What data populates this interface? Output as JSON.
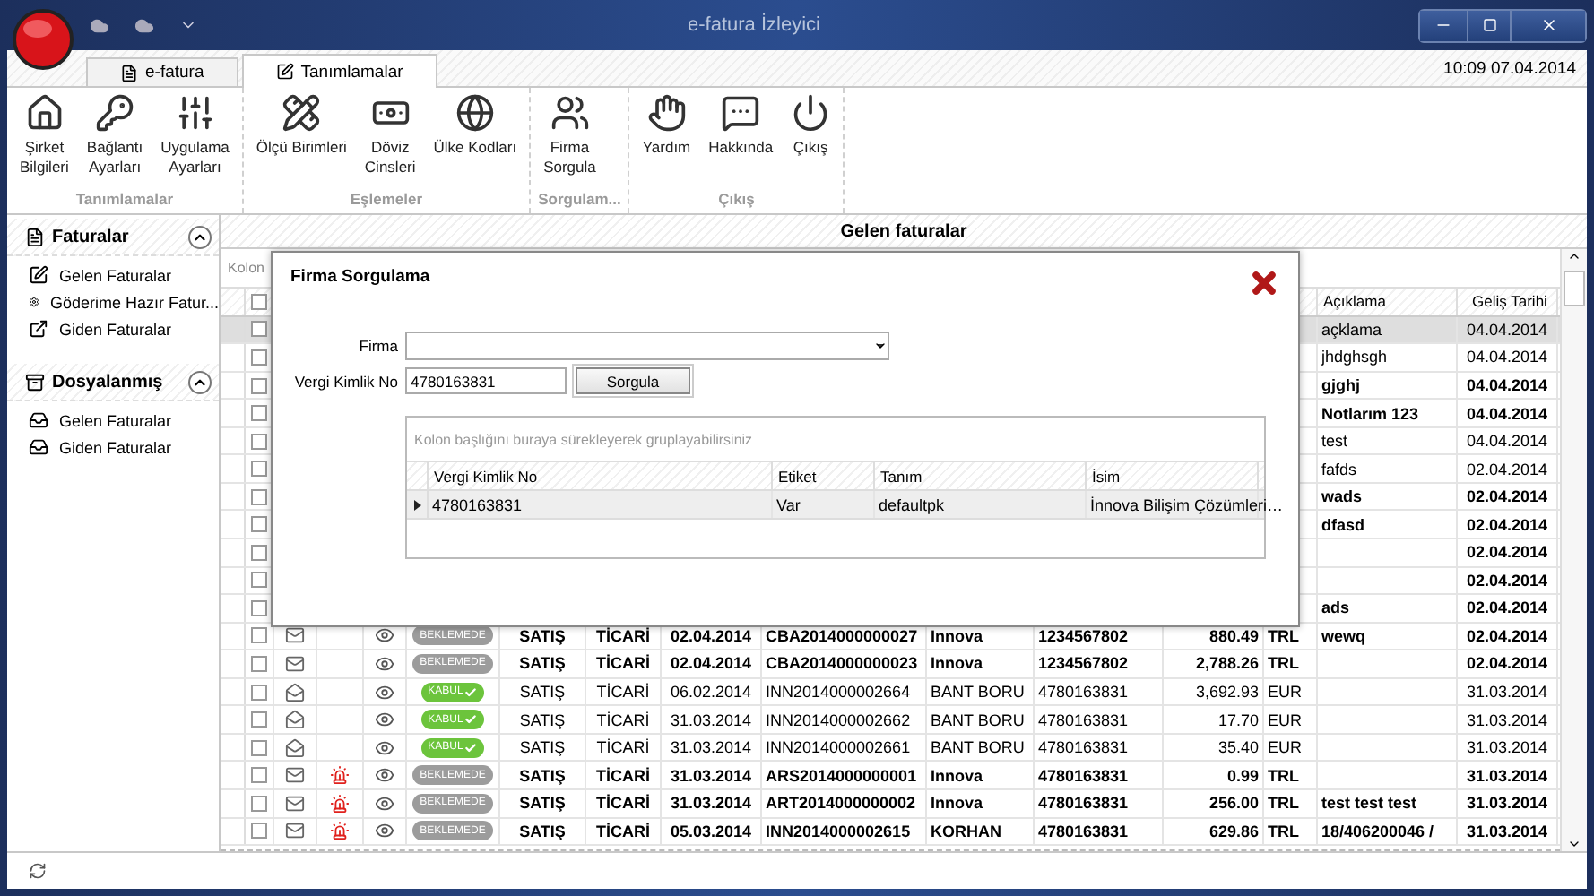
{
  "window": {
    "title": "e-fatura İzleyici",
    "time": "10:09 07.04.2014"
  },
  "ribbon": {
    "tabs": [
      {
        "label": "e-fatura",
        "selected": false
      },
      {
        "label": "Tanımlamalar",
        "selected": true
      }
    ],
    "groups": [
      {
        "label": "Tanımlamalar",
        "buttons": [
          "Şirket\nBilgileri",
          "Bağlantı\nAyarları",
          "Uygulama\nAyarları"
        ]
      },
      {
        "label": "Eşlemeler",
        "buttons": [
          "Ölçü Birimleri",
          "Döviz\nCinsleri",
          "Ülke Kodları"
        ]
      },
      {
        "label": "Sorgulam...",
        "buttons": [
          "Firma\nSorgula"
        ]
      },
      {
        "label": "Çıkış",
        "buttons": [
          "Yardım",
          "Hakkında",
          "Çıkış"
        ]
      }
    ]
  },
  "sidebar": {
    "sections": [
      {
        "title": "Faturalar",
        "expanded": true,
        "items": [
          "Gelen Faturalar",
          "Göderime Hazır Fatur...",
          "Giden Faturalar"
        ]
      },
      {
        "title": "Dosyalanmış",
        "expanded": true,
        "items": [
          "Gelen Faturalar",
          "Giden Faturalar"
        ]
      }
    ]
  },
  "grid": {
    "title": "Gelen faturalar",
    "group_hint": "Kolon",
    "all_checked": false,
    "columns": [
      "Açıklama",
      "Geliş Tarihi"
    ],
    "rows": [
      {
        "selected": true,
        "checked": false,
        "read": true,
        "description": "açklama",
        "received": "04.04.2014"
      },
      {
        "selected": false,
        "checked": false,
        "read": true,
        "description": "jhdghsgh",
        "received": "04.04.2014"
      },
      {
        "selected": false,
        "checked": false,
        "read": false,
        "description": "gjghj",
        "received": "04.04.2014"
      },
      {
        "selected": false,
        "checked": false,
        "read": false,
        "description": "Notlarım 123",
        "received": "04.04.2014"
      },
      {
        "selected": false,
        "checked": false,
        "read": true,
        "description": "test",
        "received": "04.04.2014"
      },
      {
        "selected": false,
        "checked": false,
        "read": true,
        "description": "fafds",
        "received": "02.04.2014"
      },
      {
        "selected": false,
        "checked": false,
        "read": false,
        "description": "wads",
        "received": "02.04.2014"
      },
      {
        "selected": false,
        "checked": false,
        "read": false,
        "description": "dfasd",
        "received": "02.04.2014"
      },
      {
        "selected": false,
        "checked": false,
        "read": false,
        "received": "02.04.2014"
      },
      {
        "selected": false,
        "checked": false,
        "read": false,
        "received": "02.04.2014"
      },
      {
        "selected": false,
        "checked": false,
        "read": false,
        "description": "ads",
        "received": "02.04.2014"
      },
      {
        "selected": false,
        "checked": false,
        "read": false,
        "alarm": false,
        "status": {
          "kind": "pending",
          "label": "BEKLEMEDE"
        },
        "type": "SATIŞ",
        "scenario": "TİCARİ",
        "date": "02.04.2014",
        "invoice_no": "CBA2014000000027",
        "sender": "Innova",
        "tax_no": "1234567802",
        "amount": "880.49",
        "currency": "TRL",
        "description": "wewq",
        "received": "02.04.2014"
      },
      {
        "selected": false,
        "checked": false,
        "read": false,
        "alarm": false,
        "status": {
          "kind": "pending",
          "label": "BEKLEMEDE"
        },
        "type": "SATIŞ",
        "scenario": "TİCARİ",
        "date": "02.04.2014",
        "invoice_no": "CBA2014000000023",
        "sender": "Innova",
        "tax_no": "1234567802",
        "amount": "2,788.26",
        "currency": "TRL",
        "received": "02.04.2014"
      },
      {
        "selected": false,
        "checked": false,
        "read": true,
        "alarm": false,
        "status": {
          "kind": "accepted",
          "label": "KABUL"
        },
        "type": "SATIŞ",
        "scenario": "TİCARİ",
        "date": "06.02.2014",
        "invoice_no": "INN2014000002664",
        "sender": "BANT BORU",
        "tax_no": "4780163831",
        "amount": "3,692.93",
        "currency": "EUR",
        "received": "31.03.2014"
      },
      {
        "selected": false,
        "checked": false,
        "read": true,
        "alarm": false,
        "status": {
          "kind": "accepted",
          "label": "KABUL"
        },
        "type": "SATIŞ",
        "scenario": "TİCARİ",
        "date": "31.03.2014",
        "invoice_no": "INN2014000002662",
        "sender": "BANT BORU",
        "tax_no": "4780163831",
        "amount": "17.70",
        "currency": "EUR",
        "received": "31.03.2014"
      },
      {
        "selected": false,
        "checked": false,
        "read": true,
        "alarm": false,
        "status": {
          "kind": "accepted",
          "label": "KABUL"
        },
        "type": "SATIŞ",
        "scenario": "TİCARİ",
        "date": "31.03.2014",
        "invoice_no": "INN2014000002661",
        "sender": "BANT BORU",
        "tax_no": "4780163831",
        "amount": "35.40",
        "currency": "EUR",
        "received": "31.03.2014"
      },
      {
        "selected": false,
        "checked": false,
        "read": false,
        "alarm": true,
        "status": {
          "kind": "pending",
          "label": "BEKLEMEDE"
        },
        "type": "SATIŞ",
        "scenario": "TİCARİ",
        "date": "31.03.2014",
        "invoice_no": "ARS2014000000001",
        "sender": "Innova",
        "tax_no": "4780163831",
        "amount": "0.99",
        "currency": "TRL",
        "received": "31.03.2014"
      },
      {
        "selected": false,
        "checked": false,
        "read": false,
        "alarm": true,
        "status": {
          "kind": "pending",
          "label": "BEKLEMEDE"
        },
        "type": "SATIŞ",
        "scenario": "TİCARİ",
        "date": "31.03.2014",
        "invoice_no": "ART2014000000002",
        "sender": "Innova",
        "tax_no": "4780163831",
        "amount": "256.00",
        "currency": "TRL",
        "description": "test test test",
        "received": "31.03.2014"
      },
      {
        "selected": false,
        "checked": false,
        "read": false,
        "alarm": true,
        "status": {
          "kind": "pending",
          "label": "BEKLEMEDE"
        },
        "type": "SATIŞ",
        "scenario": "TİCARİ",
        "date": "05.03.2014",
        "invoice_no": "INN2014000002615",
        "sender": "KORHAN",
        "tax_no": "4780163831",
        "amount": "629.86",
        "currency": "TRL",
        "description": "18/406200046 /",
        "received": "31.03.2014"
      }
    ]
  },
  "dialog": {
    "title": "Firma Sorgulama",
    "fields": [
      {
        "kind": "combo",
        "label": "Firma"
      },
      {
        "kind": "text",
        "label": "Vergi Kimlik No",
        "value": "4780163831",
        "button": "Sorgula"
      }
    ],
    "results": {
      "group_hint": "Kolon başlığını buraya sürekleyerek gruplayabilirsiniz",
      "columns": [
        "Vergi Kimlik No",
        "Etiket",
        "Tanım",
        "İsim"
      ],
      "rows": [
        {
          "selected": true,
          "cells": [
            "4780163831",
            "Var",
            "defaultpk",
            "İnnova Bilişim Çözümleri…"
          ]
        }
      ]
    }
  }
}
